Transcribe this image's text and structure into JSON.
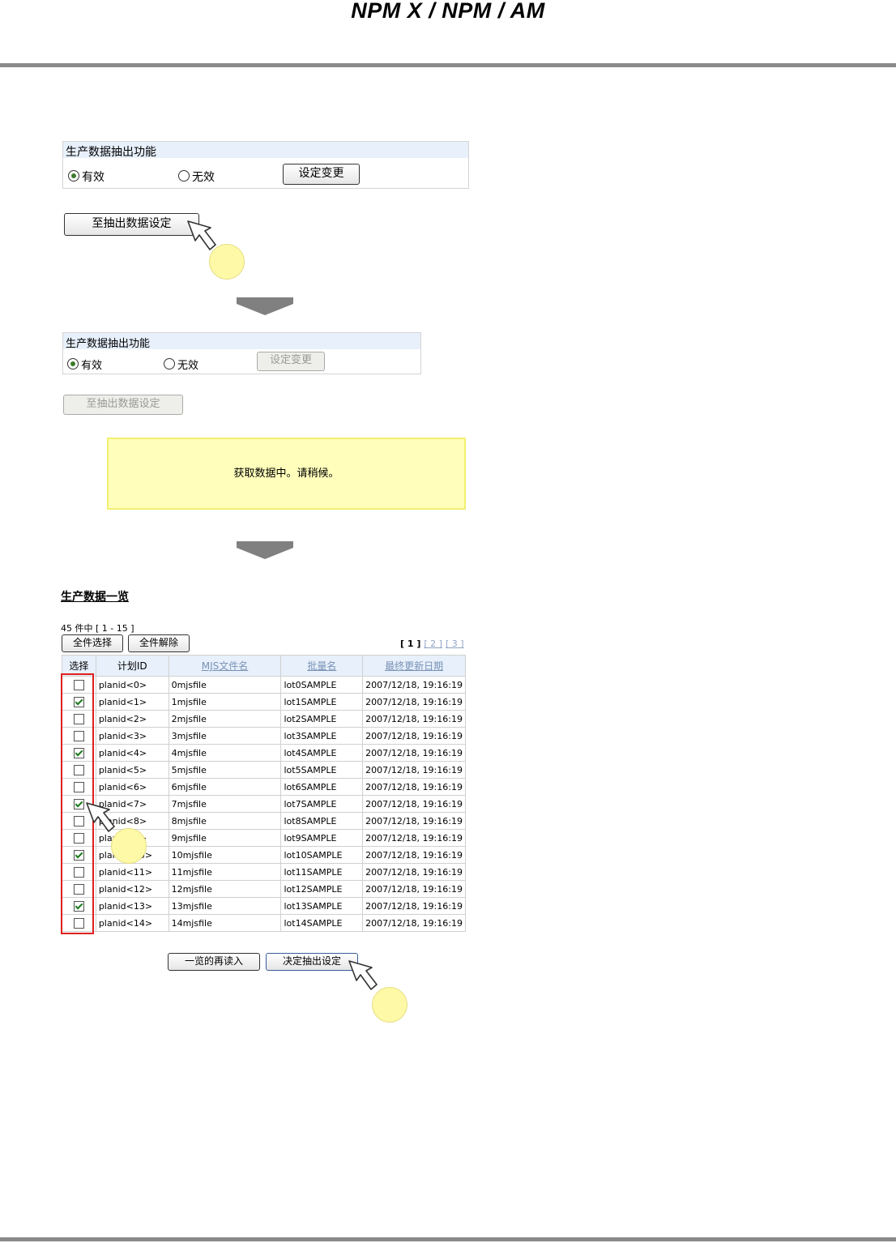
{
  "header": {
    "title": "NPM X / NPM / AM"
  },
  "panel1": {
    "heading": "生产数据抽出功能",
    "option_enabled": "有效",
    "option_disabled": "无效",
    "change_button": "设定变更"
  },
  "goto_button": "至抽出数据设定",
  "panel2": {
    "heading": "生产数据抽出功能",
    "option_enabled": "有效",
    "option_disabled": "无效",
    "change_button": "设定变更"
  },
  "goto_button_disabled": "至抽出数据设定",
  "loading_message": "获取数据中。请稍候。",
  "list": {
    "title": "生产数据一览",
    "count": "45 件中 [ 1 - 15 ]",
    "select_all": "全件选择",
    "clear_all": "全件解除",
    "pager": {
      "current": "[ 1 ]",
      "p2": "[ 2 ]",
      "p3": "[ 3 ]"
    },
    "columns": [
      "选择",
      "计划ID",
      "MJS文件名",
      "批量名",
      "最终更新日期"
    ],
    "rows": [
      {
        "checked": false,
        "plan_id": "planid<0>",
        "mjs": "0mjsfile",
        "lot": "lot0SAMPLE",
        "date": "2007/12/18, 19:16:19"
      },
      {
        "checked": true,
        "plan_id": "planid<1>",
        "mjs": "1mjsfile",
        "lot": "lot1SAMPLE",
        "date": "2007/12/18, 19:16:19"
      },
      {
        "checked": false,
        "plan_id": "planid<2>",
        "mjs": "2mjsfile",
        "lot": "lot2SAMPLE",
        "date": "2007/12/18, 19:16:19"
      },
      {
        "checked": false,
        "plan_id": "planid<3>",
        "mjs": "3mjsfile",
        "lot": "lot3SAMPLE",
        "date": "2007/12/18, 19:16:19"
      },
      {
        "checked": true,
        "plan_id": "planid<4>",
        "mjs": "4mjsfile",
        "lot": "lot4SAMPLE",
        "date": "2007/12/18, 19:16:19"
      },
      {
        "checked": false,
        "plan_id": "planid<5>",
        "mjs": "5mjsfile",
        "lot": "lot5SAMPLE",
        "date": "2007/12/18, 19:16:19"
      },
      {
        "checked": false,
        "plan_id": "planid<6>",
        "mjs": "6mjsfile",
        "lot": "lot6SAMPLE",
        "date": "2007/12/18, 19:16:19"
      },
      {
        "checked": true,
        "plan_id": "planid<7>",
        "mjs": "7mjsfile",
        "lot": "lot7SAMPLE",
        "date": "2007/12/18, 19:16:19"
      },
      {
        "checked": false,
        "plan_id": "planid<8>",
        "mjs": "8mjsfile",
        "lot": "lot8SAMPLE",
        "date": "2007/12/18, 19:16:19"
      },
      {
        "checked": false,
        "plan_id": "planid<9>",
        "mjs": "9mjsfile",
        "lot": "lot9SAMPLE",
        "date": "2007/12/18, 19:16:19"
      },
      {
        "checked": true,
        "plan_id": "planid<10>",
        "mjs": "10mjsfile",
        "lot": "lot10SAMPLE",
        "date": "2007/12/18, 19:16:19"
      },
      {
        "checked": false,
        "plan_id": "planid<11>",
        "mjs": "11mjsfile",
        "lot": "lot11SAMPLE",
        "date": "2007/12/18, 19:16:19"
      },
      {
        "checked": false,
        "plan_id": "planid<12>",
        "mjs": "12mjsfile",
        "lot": "lot12SAMPLE",
        "date": "2007/12/18, 19:16:19"
      },
      {
        "checked": true,
        "plan_id": "planid<13>",
        "mjs": "13mjsfile",
        "lot": "lot13SAMPLE",
        "date": "2007/12/18, 19:16:19"
      },
      {
        "checked": false,
        "plan_id": "planid<14>",
        "mjs": "14mjsfile",
        "lot": "lot14SAMPLE",
        "date": "2007/12/18, 19:16:19"
      }
    ],
    "reload_button": "一览的再读入",
    "confirm_button": "决定抽出设定"
  },
  "icons": {
    "cursor": "hand-pointer-icon",
    "arrow": "down-arrow-icon"
  }
}
